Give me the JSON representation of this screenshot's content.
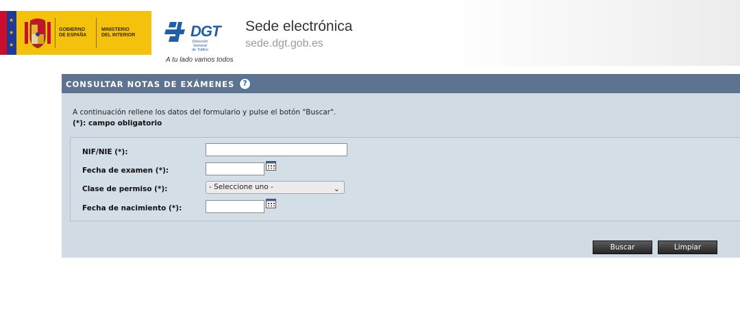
{
  "header": {
    "gov_line1": [
      "GOBIERNO",
      "DE ESPAÑA"
    ],
    "gov_line2": [
      "MINISTERIO",
      "DEL INTERIOR"
    ],
    "dgt_word": "DGT",
    "dgt_sub": [
      "Dirección General",
      "de Tráfico"
    ],
    "tagline": "A tu lado vamos todos",
    "site_title": "Sede electrónica",
    "site_url": "sede.dgt.gob.es"
  },
  "panel": {
    "title": "CONSULTAR NOTAS DE EXÁMENES",
    "help_glyph": "?",
    "intro": "A continuación rellene los datos del formulario y pulse el botón \"Buscar\".",
    "required_note": "(*): campo obligatorio"
  },
  "form": {
    "nif_label": "NIF/NIE (*):",
    "nif_value": "",
    "exam_date_label": "Fecha de examen (*):",
    "exam_date_value": "",
    "permit_label": "Clase de permiso (*):",
    "permit_selected": "- Seleccione uno -",
    "birth_date_label": "Fecha de nacimiento (*):",
    "birth_date_value": ""
  },
  "buttons": {
    "search": "Buscar",
    "clear": "Limpiar"
  },
  "colors": {
    "panel_header": "#5d7390",
    "panel_body": "#d0dbe3",
    "gov_yellow": "#f4c20d",
    "dgt_blue": "#1f5fa8"
  }
}
